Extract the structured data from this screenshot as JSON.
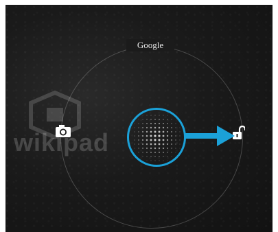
{
  "lockscreen": {
    "google_label": "Google",
    "logo_text": "wikipad",
    "left_target_icon": "camera-icon",
    "right_target_icon": "unlock-icon",
    "accent_color": "#1ba1d8"
  }
}
